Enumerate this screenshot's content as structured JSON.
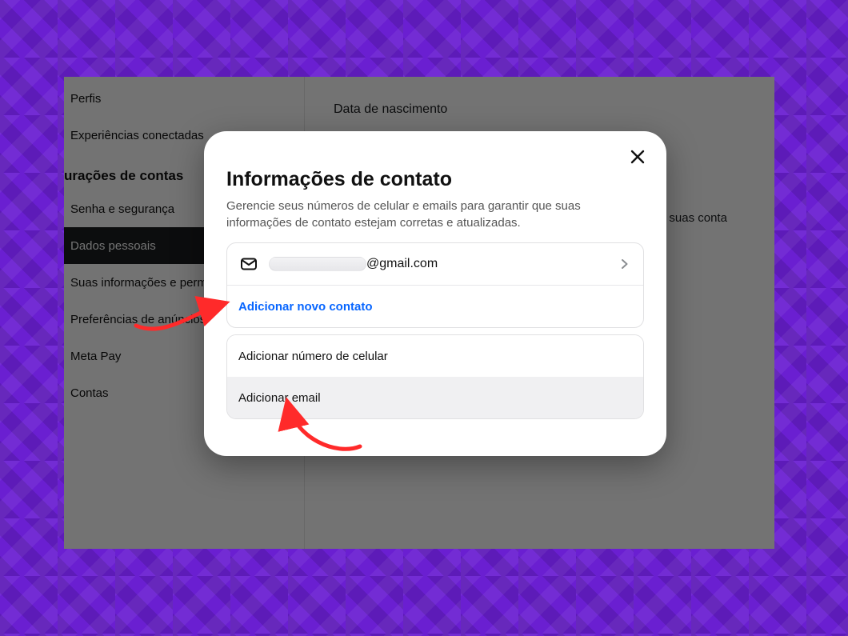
{
  "sidebar": {
    "items": [
      {
        "label": "Perfis"
      },
      {
        "label": "Experiências conectadas"
      }
    ],
    "heading": "urações de contas",
    "section": [
      {
        "label": "Senha e segurança"
      },
      {
        "label": "Dados pessoais"
      },
      {
        "label": "Suas informações e perm"
      },
      {
        "label": "Preferências de anúncios"
      },
      {
        "label": "Meta Pay"
      },
      {
        "label": "Contas"
      }
    ]
  },
  "main": {
    "dob_label": "Data de nascimento",
    "right_fragment": "ou exclua suas conta"
  },
  "modal": {
    "title": "Informações de contato",
    "description": "Gerencie seus números de celular e emails para garantir que suas informações de contato estejam corretas e atualizadas.",
    "email_domain": "@gmail.com",
    "add_contact_label": "Adicionar novo contato",
    "option_phone": "Adicionar número de celular",
    "option_email": "Adicionar email"
  },
  "annotation": {
    "color": "#ff2a2a"
  }
}
